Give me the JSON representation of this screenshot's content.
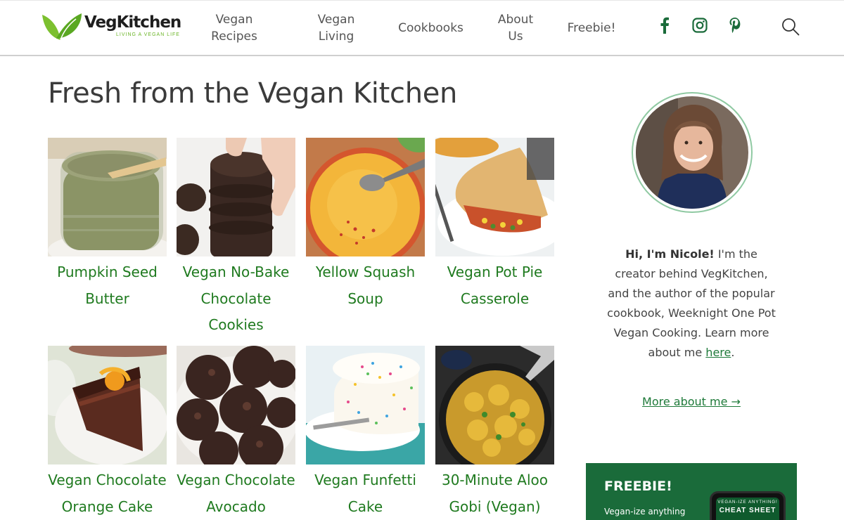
{
  "brand": {
    "name": "VegKitchen",
    "tagline": "LIVING A VEGAN LIFE",
    "green": "#6bb527",
    "dark_green": "#1a6b3a"
  },
  "nav": {
    "items": [
      {
        "label": "Vegan\nRecipes"
      },
      {
        "label": "Vegan\nLiving"
      },
      {
        "label": "Cookbooks"
      },
      {
        "label": "About\nUs"
      },
      {
        "label": "Freebie!"
      }
    ],
    "social": [
      "facebook-icon",
      "instagram-icon",
      "pinterest-icon"
    ],
    "search_icon": "search-icon"
  },
  "main": {
    "title": "Fresh from the Vegan Kitchen",
    "recipes": [
      {
        "title": "Pumpkin Seed Butter",
        "image": "pumpkin-seed-butter-jar"
      },
      {
        "title": "Vegan No-Bake Chocolate Cookies",
        "image": "stacked-chocolate-cookies"
      },
      {
        "title": "Yellow Squash Soup",
        "image": "yellow-soup-bowl"
      },
      {
        "title": "Vegan Pot Pie Casserole",
        "image": "pot-pie-slice"
      },
      {
        "title": "Vegan Chocolate Orange Cake",
        "image": "chocolate-cake-slice"
      },
      {
        "title": "Vegan Chocolate Avocado",
        "image": "chocolate-avocado-cookies"
      },
      {
        "title": "Vegan Funfetti Cake",
        "image": "funfetti-cake"
      },
      {
        "title": "30-Minute Aloo Gobi (Vegan)",
        "image": "aloo-gobi-skillet"
      }
    ],
    "link_color": "#1f7a1f"
  },
  "sidebar": {
    "bio": {
      "greeting": "Hi, I'm Nicole!",
      "text_before_link": " I'm the creator behind VegKitchen, and the author of the popular cookbook, Weeknight One Pot Vegan Cooking. Learn more about me ",
      "link_text": "here",
      "text_after_link": "."
    },
    "more_link": "More about me →",
    "freebie": {
      "title": "FREEBIE!",
      "subtitle": "Vegan-ize anything",
      "phone_small": "VEGAN-IZE ANYTHING!",
      "phone_big": "CHEAT SHEET"
    }
  }
}
